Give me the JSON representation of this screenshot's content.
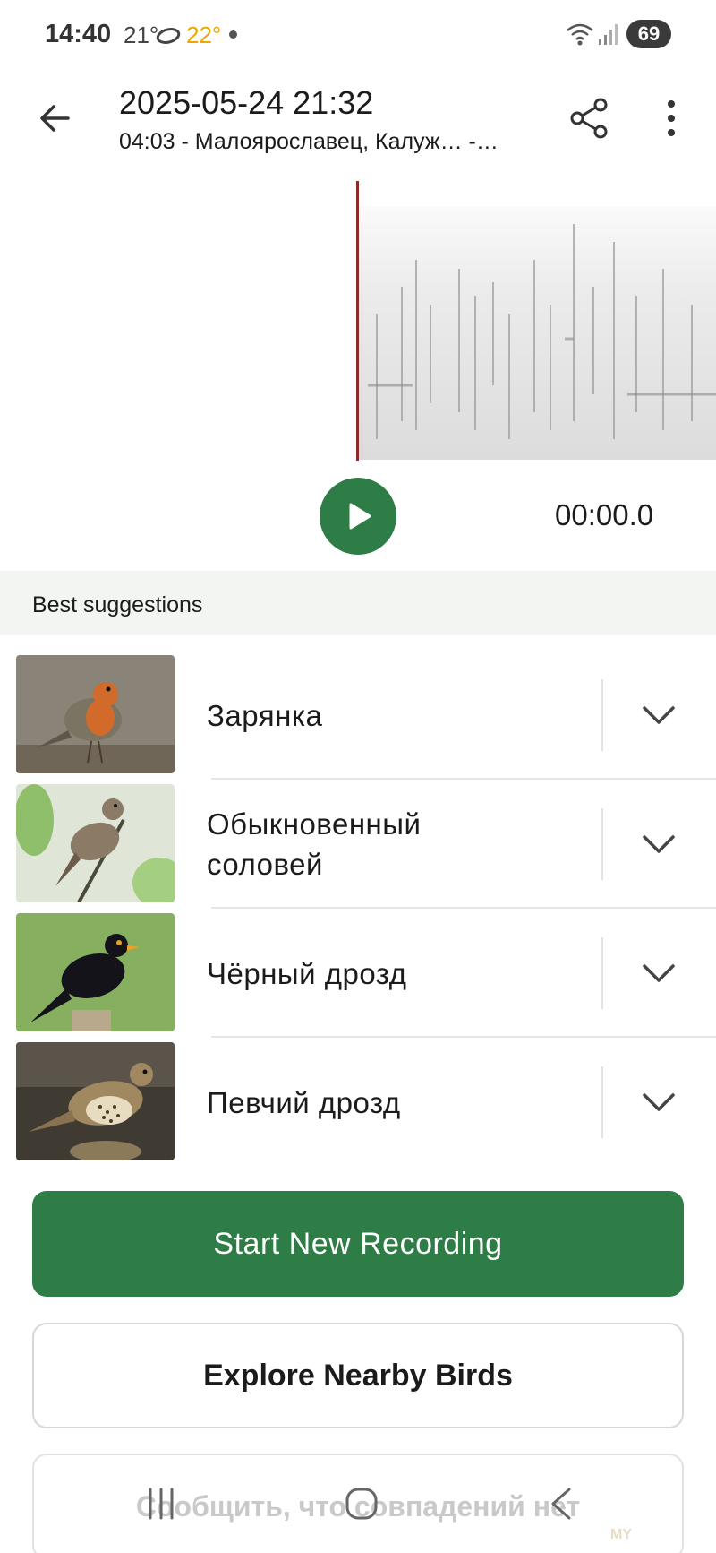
{
  "status_bar": {
    "time": "14:40",
    "temp_1": "21°",
    "temp_2": "22°",
    "battery": "69"
  },
  "header": {
    "title": "2025-05-24 21:32",
    "subtitle": "04:03 - Малоярославец, Калуж… -…",
    "back_icon": "arrow-left-icon",
    "share_icon": "share-icon",
    "more_icon": "more-vertical-icon"
  },
  "player": {
    "time": "00:00.0",
    "play_icon": "play-icon"
  },
  "suggestions": {
    "title": "Best suggestions",
    "items": [
      {
        "name": "Зарянка",
        "image": "robin-photo"
      },
      {
        "name": "Обыкновенный соловей",
        "image": "nightingale-photo"
      },
      {
        "name": "Чёрный дрозд",
        "image": "blackbird-photo"
      },
      {
        "name": "Певчий дрозд",
        "image": "song-thrush-photo"
      }
    ]
  },
  "actions": {
    "start_recording": "Start New Recording",
    "explore": "Explore Nearby Birds",
    "report_no_match": "Сообщить, что совпадений нет"
  },
  "watermark": "MY",
  "colors": {
    "accent": "#2e7d46",
    "playhead": "#8e2a2a"
  }
}
